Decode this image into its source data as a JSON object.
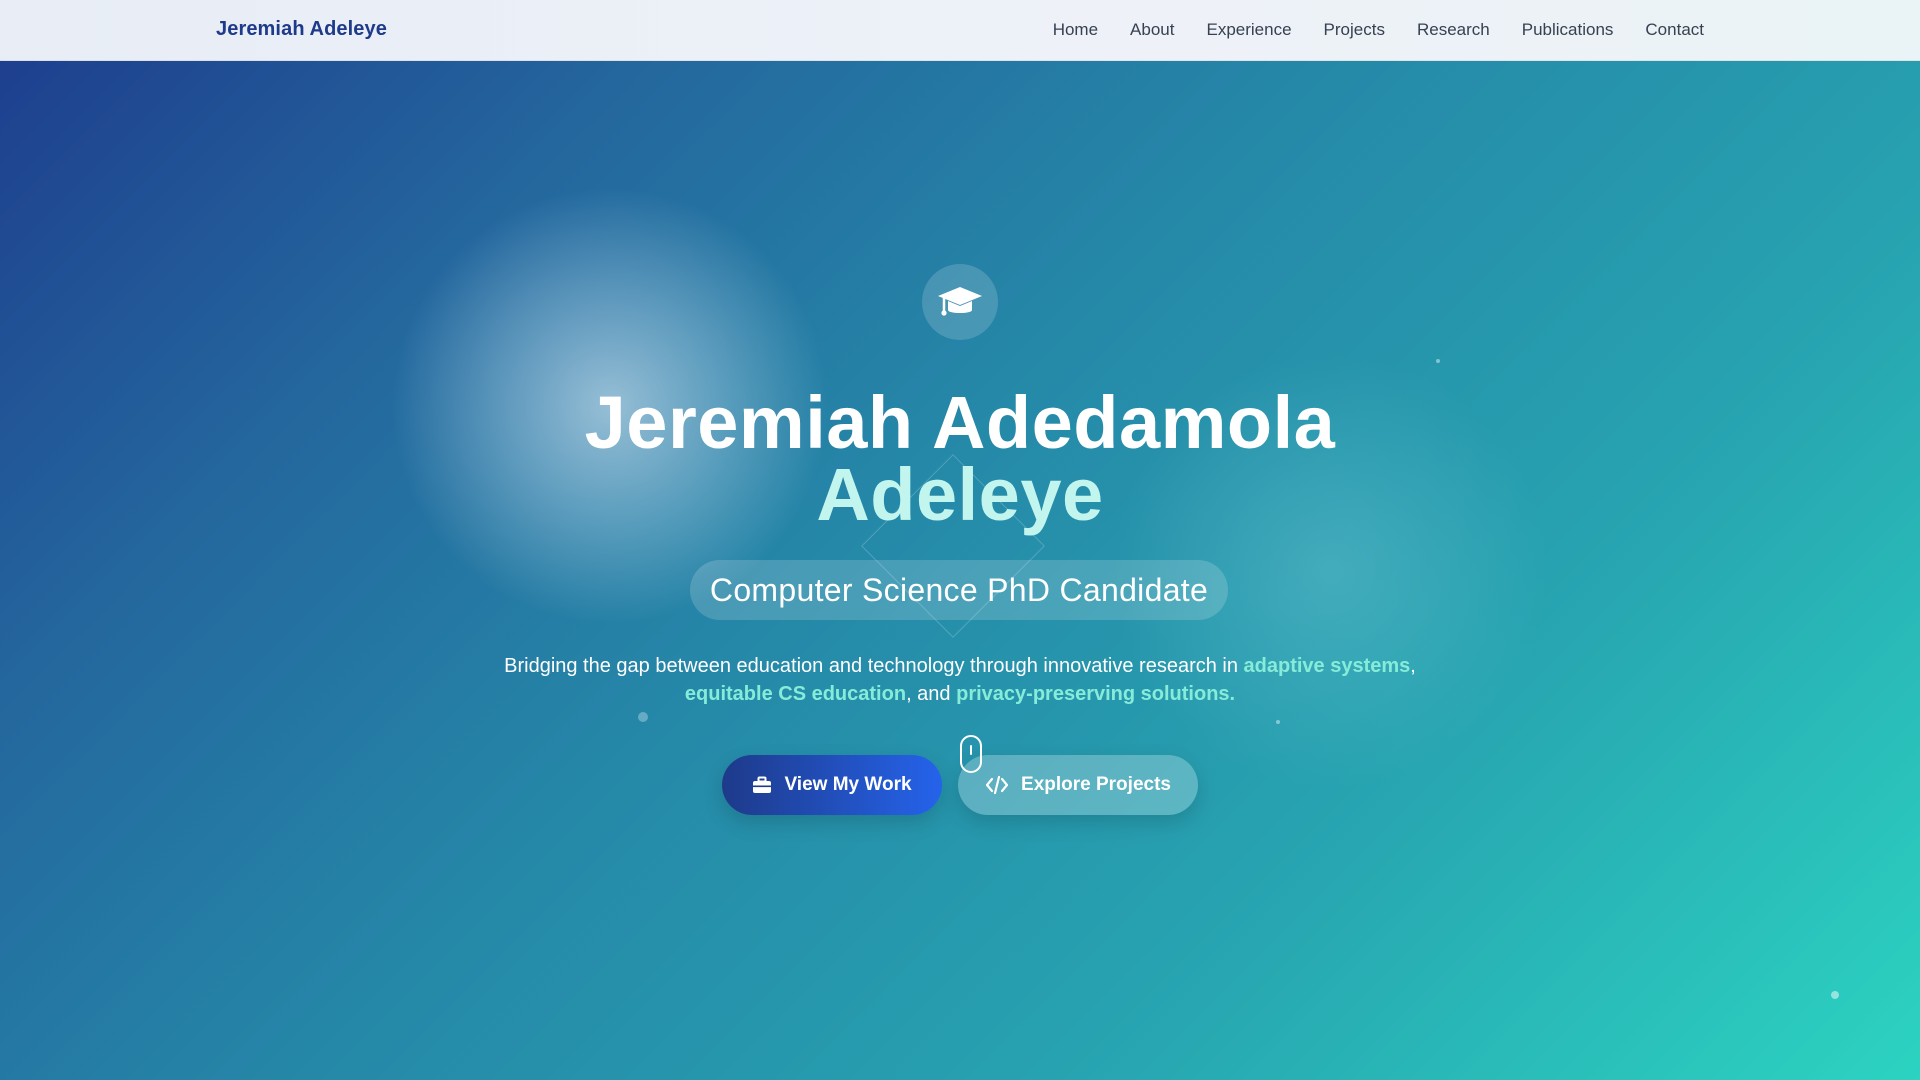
{
  "nav": {
    "brand": "Jeremiah Adeleye",
    "links": [
      "Home",
      "About",
      "Experience",
      "Projects",
      "Research",
      "Publications",
      "Contact"
    ]
  },
  "hero": {
    "icon": "graduation-cap-icon",
    "title_line1": "Jeremiah Adedamola",
    "title_line2": "Adeleye",
    "subtitle": "Computer Science PhD Candidate",
    "tagline": {
      "part1": "Bridging the gap between education and technology through innovative research in ",
      "hl1": "adaptive systems",
      "sep1": ", ",
      "hl2": "equitable CS education",
      "sep2": ", and ",
      "hl3": "privacy-preserving solutions",
      "end": "."
    },
    "primary_button": {
      "label": "View My Work",
      "icon": "briefcase-icon"
    },
    "secondary_button": {
      "label": "Explore Projects",
      "icon": "code-icon"
    },
    "scroll_indicator_icon": "mouse-scroll-icon"
  },
  "colors": {
    "brand": "#1e3a8a",
    "gradient_start": "#1e3f8e",
    "gradient_end": "#2cd3c1",
    "highlight": "#86ecd9",
    "title_accent": "#c3f5ef"
  }
}
